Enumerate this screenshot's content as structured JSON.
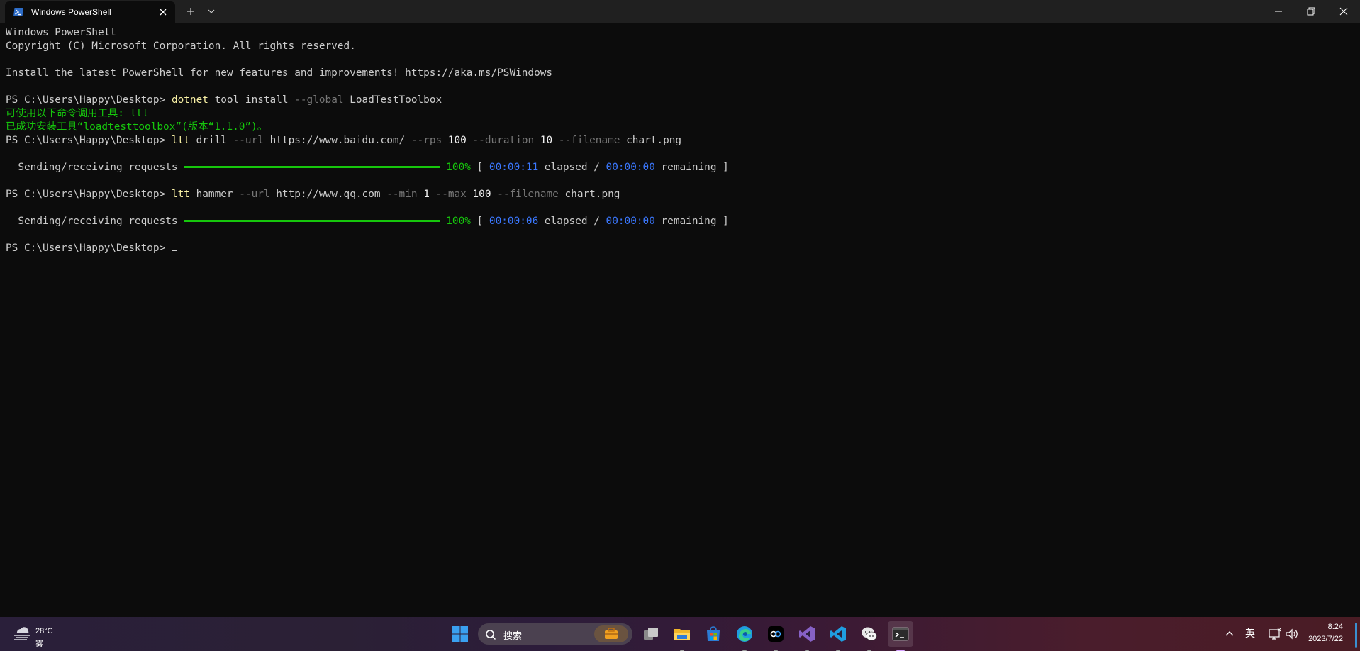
{
  "window": {
    "tab_title": "Windows PowerShell"
  },
  "terminal": {
    "lines": [
      {
        "segments": [
          {
            "text": "Windows PowerShell",
            "c": ""
          }
        ]
      },
      {
        "segments": [
          {
            "text": "Copyright (C) Microsoft Corporation. All rights reserved.",
            "c": ""
          }
        ]
      },
      {
        "segments": [
          {
            "text": "",
            "c": ""
          }
        ]
      },
      {
        "segments": [
          {
            "text": "Install the latest PowerShell for new features and improvements! https://aka.ms/PSWindows",
            "c": ""
          }
        ]
      },
      {
        "segments": [
          {
            "text": "",
            "c": ""
          }
        ]
      },
      {
        "segments": [
          {
            "text": "PS C:\\Users\\Happy\\Desktop> ",
            "c": ""
          },
          {
            "text": "dotnet",
            "c": "c-y"
          },
          {
            "text": " tool install ",
            "c": ""
          },
          {
            "text": "--global",
            "c": "c-g"
          },
          {
            "text": " LoadTestToolbox",
            "c": ""
          }
        ]
      },
      {
        "segments": [
          {
            "text": "可使用以下命令调用工具: ltt",
            "c": "c-green"
          }
        ]
      },
      {
        "segments": [
          {
            "text": "已成功安装工具“loadtesttoolbox”(版本“1.1.0”)。",
            "c": "c-green"
          }
        ]
      },
      {
        "segments": [
          {
            "text": "PS C:\\Users\\Happy\\Desktop> ",
            "c": ""
          },
          {
            "text": "ltt",
            "c": "c-y"
          },
          {
            "text": " drill ",
            "c": ""
          },
          {
            "text": "--url",
            "c": "c-g"
          },
          {
            "text": " https://www.baidu.com/ ",
            "c": ""
          },
          {
            "text": "--rps",
            "c": "c-g"
          },
          {
            "text": " 100 ",
            "c": "c-w"
          },
          {
            "text": "--duration",
            "c": "c-g"
          },
          {
            "text": " 10 ",
            "c": "c-w"
          },
          {
            "text": "--filename",
            "c": "c-g"
          },
          {
            "text": " chart.png",
            "c": ""
          }
        ]
      },
      {
        "segments": [
          {
            "text": "",
            "c": ""
          }
        ]
      },
      {
        "progress": {
          "label": "  Sending/receiving requests ",
          "percent": "100%",
          "elapsed": "00:00:11",
          "elapsed_word": " elapsed / ",
          "remaining": "00:00:00",
          "remaining_word": " remaining ]",
          "open_bracket": " [ "
        }
      },
      {
        "segments": [
          {
            "text": "",
            "c": ""
          }
        ]
      },
      {
        "segments": [
          {
            "text": "PS C:\\Users\\Happy\\Desktop> ",
            "c": ""
          },
          {
            "text": "ltt",
            "c": "c-y"
          },
          {
            "text": " hammer ",
            "c": ""
          },
          {
            "text": "--url",
            "c": "c-g"
          },
          {
            "text": " http://www.qq.com ",
            "c": ""
          },
          {
            "text": "--min",
            "c": "c-g"
          },
          {
            "text": " 1 ",
            "c": "c-w"
          },
          {
            "text": "--max",
            "c": "c-g"
          },
          {
            "text": " 100 ",
            "c": "c-w"
          },
          {
            "text": "--filename",
            "c": "c-g"
          },
          {
            "text": " chart.png",
            "c": ""
          }
        ]
      },
      {
        "segments": [
          {
            "text": "",
            "c": ""
          }
        ]
      },
      {
        "progress": {
          "label": "  Sending/receiving requests ",
          "percent": "100%",
          "elapsed": "00:00:06",
          "elapsed_word": " elapsed / ",
          "remaining": "00:00:00",
          "remaining_word": " remaining ]",
          "open_bracket": " [ "
        }
      },
      {
        "segments": [
          {
            "text": "",
            "c": ""
          }
        ]
      },
      {
        "segments": [
          {
            "text": "PS C:\\Users\\Happy\\Desktop> ",
            "c": ""
          }
        ],
        "cursor": true
      }
    ]
  },
  "taskbar": {
    "weather": {
      "temp": "28°C",
      "condition": "雾"
    },
    "search_placeholder": "搜索",
    "apps": [
      {
        "name": "start-button",
        "icon": "windows-logo-icon"
      },
      {
        "name": "task-view-button",
        "icon": "task-view-icon"
      },
      {
        "name": "file-explorer-button",
        "icon": "folder-icon"
      },
      {
        "name": "microsoft-store-button",
        "icon": "store-icon"
      },
      {
        "name": "edge-button",
        "icon": "edge-icon"
      },
      {
        "name": "jetbrains-rider-button",
        "icon": "rider-icon"
      },
      {
        "name": "visual-studio-button",
        "icon": "visual-studio-icon"
      },
      {
        "name": "vscode-button",
        "icon": "vscode-icon"
      },
      {
        "name": "wechat-button",
        "icon": "wechat-icon"
      },
      {
        "name": "terminal-button",
        "icon": "terminal-icon"
      }
    ],
    "ime": "英",
    "time": "8:24",
    "date": "2023/7/22"
  },
  "colors": {
    "accent": "#16c60c",
    "link_blue": "#3b78ff",
    "command_yellow": "#f9f1a5",
    "param_gray": "#767676"
  }
}
